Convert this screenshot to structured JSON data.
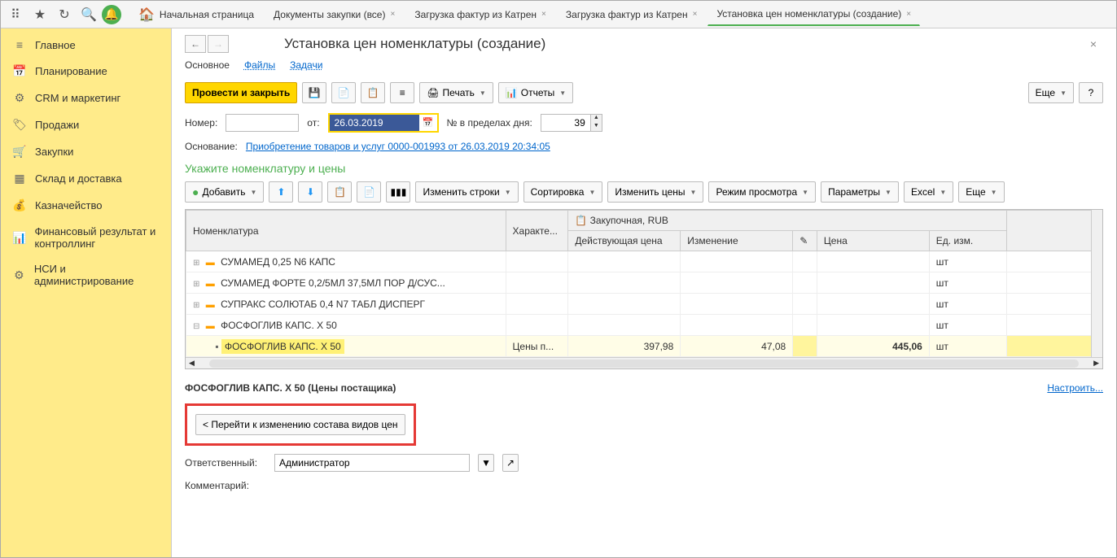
{
  "tabs": [
    {
      "label": "Начальная страница",
      "closable": false,
      "home": true
    },
    {
      "label": "Документы закупки (все)",
      "closable": true
    },
    {
      "label": "Загрузка фактур из Катрен",
      "closable": true
    },
    {
      "label": "Загрузка фактур из Катрен",
      "closable": true
    },
    {
      "label": "Установка цен номенклатуры (создание)",
      "closable": true,
      "active": true
    }
  ],
  "sidebar": [
    {
      "icon": "≡",
      "label": "Главное"
    },
    {
      "icon": "📅",
      "label": "Планирование"
    },
    {
      "icon": "⚙",
      "label": "CRM и маркетинг"
    },
    {
      "icon": "🏷",
      "label": "Продажи"
    },
    {
      "icon": "🛒",
      "label": "Закупки"
    },
    {
      "icon": "▦",
      "label": "Склад и доставка"
    },
    {
      "icon": "💰",
      "label": "Казначейство"
    },
    {
      "icon": "📊",
      "label": "Финансовый результат и контроллинг"
    },
    {
      "icon": "⚙",
      "label": "НСИ и администрирование"
    }
  ],
  "page": {
    "title": "Установка цен номенклатуры (создание)",
    "subnav": {
      "main": "Основное",
      "files": "Файлы",
      "tasks": "Задачи"
    },
    "toolbar": {
      "submit": "Провести и закрыть",
      "print": "Печать",
      "reports": "Отчеты",
      "more": "Еще"
    },
    "form": {
      "number_label": "Номер:",
      "date_label": "от:",
      "date_value": "26.03.2019",
      "day_num_label": "№ в пределах дня:",
      "day_num_value": "39",
      "basis_label": "Основание:",
      "basis_link": "Приобретение товаров и услуг 0000-001993 от 26.03.2019 20:34:05"
    },
    "section_title": "Укажите номенклатуру и цены",
    "table_toolbar": {
      "add": "Добавить",
      "change_rows": "Изменить строки",
      "sort": "Сортировка",
      "change_prices": "Изменить цены",
      "view_mode": "Режим просмотра",
      "params": "Параметры",
      "excel": "Excel",
      "more": "Еще"
    },
    "table": {
      "headers": {
        "nomenclature": "Номенклатура",
        "char": "Характе...",
        "purchase": "Закупочная, RUB",
        "current_price": "Действующая цена",
        "change": "Изменение",
        "price": "Цена",
        "unit": "Ед. изм."
      },
      "rows": [
        {
          "name": "СУМАМЕД 0,25 N6 КАПС",
          "unit": "шт"
        },
        {
          "name": "СУМАМЕД ФОРТЕ 0,2/5МЛ 37,5МЛ ПОР Д/СУС...",
          "unit": "шт"
        },
        {
          "name": "СУПРАКС СОЛЮТАБ 0,4 N7 ТАБЛ ДИСПЕРГ",
          "unit": "шт"
        },
        {
          "name": "ФОСФОГЛИВ КАПС. X 50",
          "unit": "шт",
          "expanded": true
        },
        {
          "name": "ФОСФОГЛИВ КАПС. X 50",
          "char": "Цены п...",
          "current": "397,98",
          "change": "47,08",
          "price": "445,06",
          "unit": "шт",
          "child": true,
          "selected": true
        }
      ]
    },
    "detail": {
      "label": "ФОСФОГЛИВ КАПС. X 50 (Цены постащика)",
      "config": "Настроить..."
    },
    "back_btn": "< Перейти к изменению состава видов цен",
    "responsible_label": "Ответственный:",
    "responsible_value": "Администратор",
    "comment_label": "Комментарий:"
  }
}
